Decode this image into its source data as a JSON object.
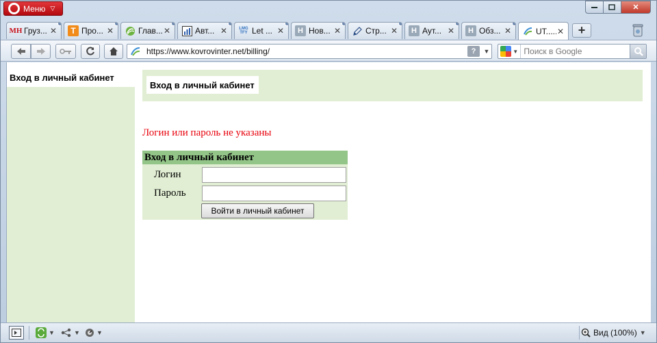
{
  "browser": {
    "menu_label": "Меню",
    "tabs": [
      {
        "label": "Груз...",
        "icon": "mh-icon",
        "badge": "МН",
        "active": false
      },
      {
        "label": "Про...",
        "icon": "t-icon",
        "badge": "T",
        "active": false
      },
      {
        "label": "Глав...",
        "icon": "green-swirl-icon",
        "badge": "",
        "active": false
      },
      {
        "label": "Авт...",
        "icon": "bar-chart-icon",
        "badge": "",
        "active": false
      },
      {
        "label": "Let ...",
        "icon": "lmgtfy-icon",
        "badge": "LMG TFY",
        "active": false
      },
      {
        "label": "Нов...",
        "icon": "h-icon",
        "badge": "H",
        "active": false
      },
      {
        "label": "Стр...",
        "icon": "pencil-icon",
        "badge": "",
        "active": false
      },
      {
        "label": "Аут...",
        "icon": "h-icon",
        "badge": "H",
        "active": false
      },
      {
        "label": "Обз...",
        "icon": "h-icon",
        "badge": "H",
        "active": false
      },
      {
        "label": "UT......",
        "icon": "site-icon",
        "badge": "",
        "active": true
      }
    ],
    "address": {
      "url": "https://www.kovrovinter.net/billing/"
    },
    "search": {
      "placeholder": "Поиск в Google"
    },
    "status": {
      "zoom_label": "Вид (100%)"
    }
  },
  "page": {
    "side_title": "Вход в личный кабинет",
    "header_title": "Вход в личный кабинет",
    "error_message": "Логин или пароль не указаны",
    "login_form": {
      "heading": "Вход в личный кабинет",
      "login_label": "Логин",
      "login_value": "",
      "password_label": "Пароль",
      "password_value": "",
      "submit_label": "Войти в личный кабинет"
    }
  },
  "colors": {
    "panel_green": "#e1eed3",
    "form_header_green": "#93c588",
    "error_red": "#e8000b",
    "opera_red": "#c8121a"
  }
}
